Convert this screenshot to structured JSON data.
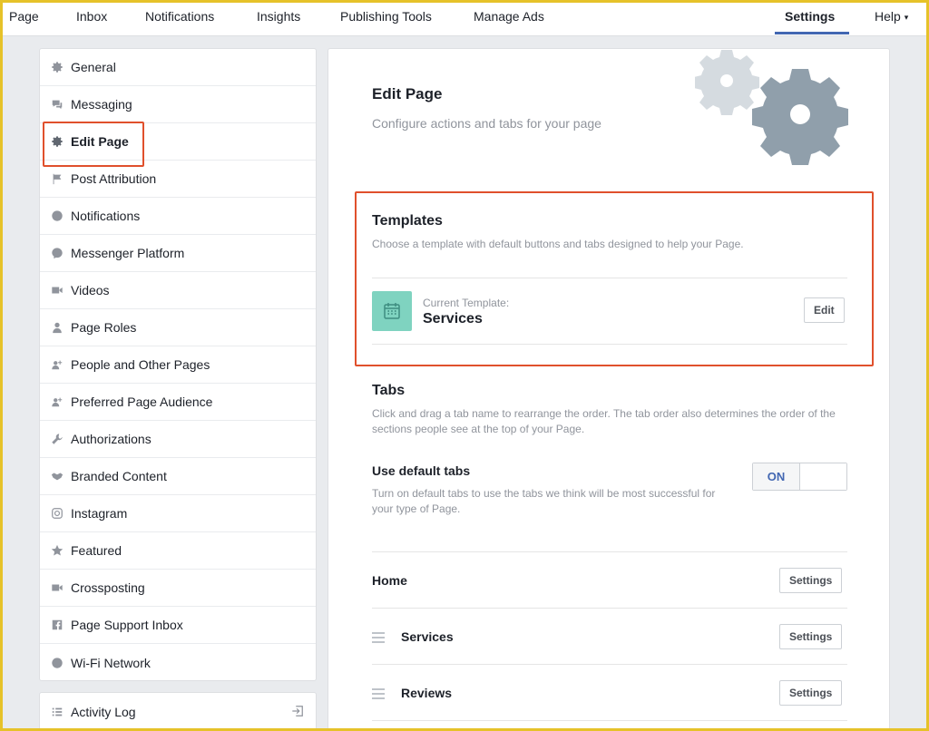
{
  "topnav": {
    "items": [
      "Page",
      "Inbox",
      "Notifications",
      "Insights",
      "Publishing Tools",
      "Manage Ads"
    ],
    "settings": "Settings",
    "help": "Help",
    "caret": "▾"
  },
  "sidebar": {
    "items": [
      {
        "label": "General",
        "icon": "gear-icon"
      },
      {
        "label": "Messaging",
        "icon": "messaging-icon"
      },
      {
        "label": "Edit Page",
        "icon": "gear-icon"
      },
      {
        "label": "Post Attribution",
        "icon": "flag-icon"
      },
      {
        "label": "Notifications",
        "icon": "globe-icon"
      },
      {
        "label": "Messenger Platform",
        "icon": "messenger-icon"
      },
      {
        "label": "Videos",
        "icon": "video-icon"
      },
      {
        "label": "Page Roles",
        "icon": "person-icon"
      },
      {
        "label": "People and Other Pages",
        "icon": "people-icon"
      },
      {
        "label": "Preferred Page Audience",
        "icon": "people-icon"
      },
      {
        "label": "Authorizations",
        "icon": "wrench-icon"
      },
      {
        "label": "Branded Content",
        "icon": "handshake-icon"
      },
      {
        "label": "Instagram",
        "icon": "instagram-icon"
      },
      {
        "label": "Featured",
        "icon": "star-icon"
      },
      {
        "label": "Crossposting",
        "icon": "video-icon"
      },
      {
        "label": "Page Support Inbox",
        "icon": "facebook-icon"
      },
      {
        "label": "Wi-Fi Network",
        "icon": "info-icon"
      }
    ],
    "activity_log": "Activity Log"
  },
  "main": {
    "title": "Edit Page",
    "subtitle": "Configure actions and tabs for your page",
    "templates": {
      "title": "Templates",
      "desc": "Choose a template with default buttons and tabs designed to help your Page.",
      "caption": "Current Template:",
      "name": "Services",
      "edit_label": "Edit"
    },
    "tabs": {
      "title": "Tabs",
      "desc": "Click and drag a tab name to rearrange the order. The tab order also determines the order of the sections people see at the top of your Page.",
      "default_title": "Use default tabs",
      "default_desc": "Turn on default tabs to use the tabs we think will be most successful for your type of Page.",
      "toggle_label": "ON",
      "rows": [
        {
          "label": "Home",
          "button": "Settings"
        },
        {
          "label": "Services",
          "button": "Settings"
        },
        {
          "label": "Reviews",
          "button": "Settings"
        }
      ]
    }
  },
  "colors": {
    "accent": "#4267b2",
    "highlight": "#e0502c",
    "template_icon_bg": "#7fd3c0",
    "frame": "#e6c229"
  }
}
